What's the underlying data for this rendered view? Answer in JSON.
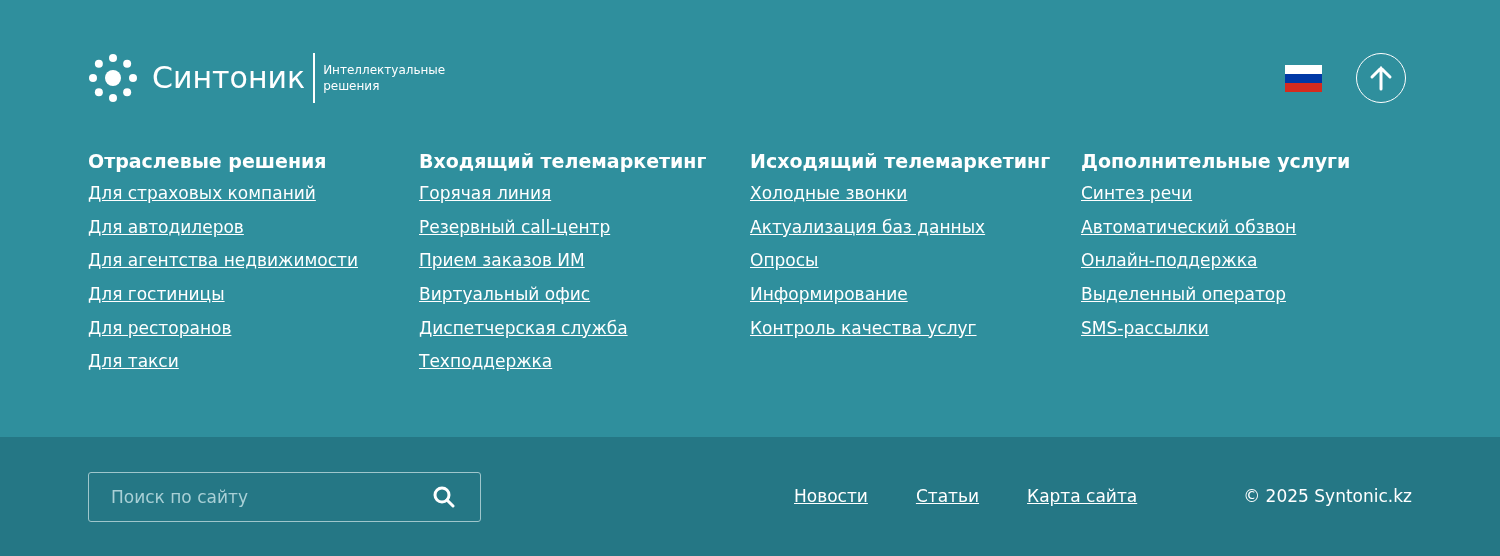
{
  "logo": {
    "name": "Синтоник",
    "tagline": "Интеллектуальные решения"
  },
  "columns": [
    {
      "title": "Отраслевые решения",
      "links": [
        "Для страховых компаний",
        "Для автодилеров",
        "Для агентства недвижимости",
        "Для гостиницы",
        "Для ресторанов",
        "Для такси"
      ]
    },
    {
      "title": "Входящий телемаркетинг",
      "links": [
        "Горячая линия",
        "Резервный call-центр",
        "Прием заказов ИМ",
        "Виртуальный офис",
        "Диспетчерская служба",
        "Техподдержка"
      ]
    },
    {
      "title": "Исходящий телемаркетинг",
      "links": [
        "Холодные звонки",
        "Актуализация баз данных",
        "Опросы",
        "Информирование",
        "Контроль качества услуг"
      ]
    },
    {
      "title": "Дополнительные услуги",
      "links": [
        "Синтез речи",
        "Автоматический обзвон",
        "Онлайн-поддержка",
        "Выделенный оператор",
        "SMS-рассылки"
      ]
    }
  ],
  "search": {
    "placeholder": "Поиск по сайту"
  },
  "bottom_links": [
    "Новости",
    "Статьи",
    "Карта сайта"
  ],
  "copyright": "© 2025 Syntonic.kz"
}
